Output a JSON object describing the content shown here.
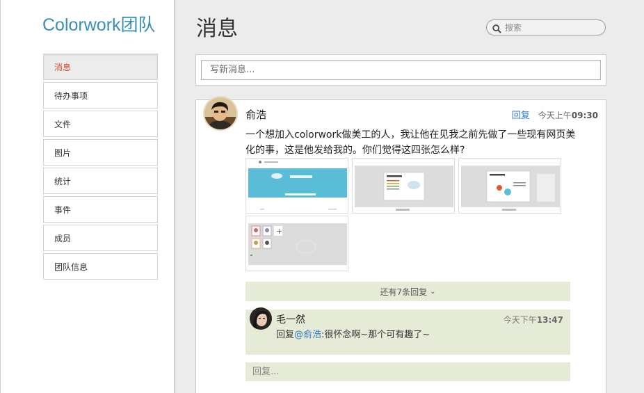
{
  "app": {
    "brand": "Colorwork团队"
  },
  "sidebar": {
    "items": [
      {
        "label": "消息",
        "active": true
      },
      {
        "label": "待办事项"
      },
      {
        "label": "文件"
      },
      {
        "label": "图片"
      },
      {
        "label": "统计"
      },
      {
        "label": "事件"
      },
      {
        "label": "成员"
      },
      {
        "label": "团队信息"
      }
    ]
  },
  "main": {
    "title": "消息",
    "search": {
      "placeholder": "搜索"
    },
    "compose": {
      "placeholder": "写新消息..."
    }
  },
  "post": {
    "author": "俞浩",
    "reply_label": "回复",
    "time_prefix": "今天上午",
    "time": "09:30",
    "body": "一个想加入colorwork做美工的人，我让他在见我之前先做了一些现有网页美化的事，这是他发给我的。你们觉得这四张怎么样?",
    "more_replies": "还有7条回复",
    "reply": {
      "author": "毛一然",
      "time_prefix": "今天下午",
      "time": "13:47",
      "text_prefix": "回复",
      "mention": "@俞浩",
      "text": ":很怀念啊~那个可有趣了~"
    },
    "reply_placeholder": "回复..."
  },
  "colors": {
    "brand": "#3a8fb7",
    "active_nav": "#d9472b",
    "link": "#2f76c4",
    "reply_bg": "#e6ebd8"
  }
}
